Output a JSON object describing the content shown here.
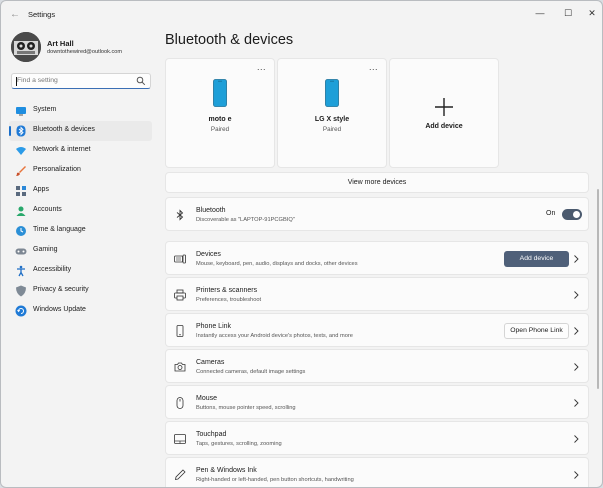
{
  "window": {
    "title": "Settings",
    "back": "←",
    "minimize": "—",
    "maximize": "☐",
    "close": "✕"
  },
  "profile": {
    "name": "Art Hall",
    "email": "downtothewired@outlook.com"
  },
  "search": {
    "placeholder": "Find a setting"
  },
  "nav": {
    "items": [
      {
        "label": "System",
        "icon": "monitor-icon"
      },
      {
        "label": "Bluetooth & devices",
        "icon": "bluetooth-icon",
        "active": true
      },
      {
        "label": "Network & internet",
        "icon": "wifi-icon"
      },
      {
        "label": "Personalization",
        "icon": "brush-icon"
      },
      {
        "label": "Apps",
        "icon": "apps-icon"
      },
      {
        "label": "Accounts",
        "icon": "person-icon"
      },
      {
        "label": "Time & language",
        "icon": "globe-clock-icon"
      },
      {
        "label": "Gaming",
        "icon": "gamepad-icon"
      },
      {
        "label": "Accessibility",
        "icon": "accessibility-icon"
      },
      {
        "label": "Privacy & security",
        "icon": "shield-icon"
      },
      {
        "label": "Windows Update",
        "icon": "update-icon"
      }
    ]
  },
  "main": {
    "title": "Bluetooth & devices",
    "cards": [
      {
        "name": "moto e",
        "status": "Paired",
        "more": "..."
      },
      {
        "name": "LG X style",
        "status": "Paired",
        "more": "..."
      }
    ],
    "add_device_card": {
      "label": "Add device"
    },
    "view_more": "View more devices",
    "bluetooth": {
      "title": "Bluetooth",
      "subtitle": "Discoverable as \"LAPTOP-91PCGBIQ\"",
      "state": "On"
    },
    "rows": [
      {
        "title": "Devices",
        "subtitle": "Mouse, keyboard, pen, audio, displays and docks, other devices",
        "button": "Add device"
      },
      {
        "title": "Printers & scanners",
        "subtitle": "Preferences, troubleshoot"
      },
      {
        "title": "Phone Link",
        "subtitle": "Instantly access your Android device's photos, texts, and more",
        "button": "Open Phone Link"
      },
      {
        "title": "Cameras",
        "subtitle": "Connected cameras, default image settings"
      },
      {
        "title": "Mouse",
        "subtitle": "Buttons, mouse pointer speed, scrolling"
      },
      {
        "title": "Touchpad",
        "subtitle": "Taps, gestures, scrolling, zooming"
      },
      {
        "title": "Pen & Windows Ink",
        "subtitle": "Right-handed or left-handed, pen button shortcuts, handwriting"
      }
    ]
  },
  "colors": {
    "accent": "#1a6ec9",
    "primary_button": "#4f6079",
    "phone": "#1e9fd8"
  }
}
